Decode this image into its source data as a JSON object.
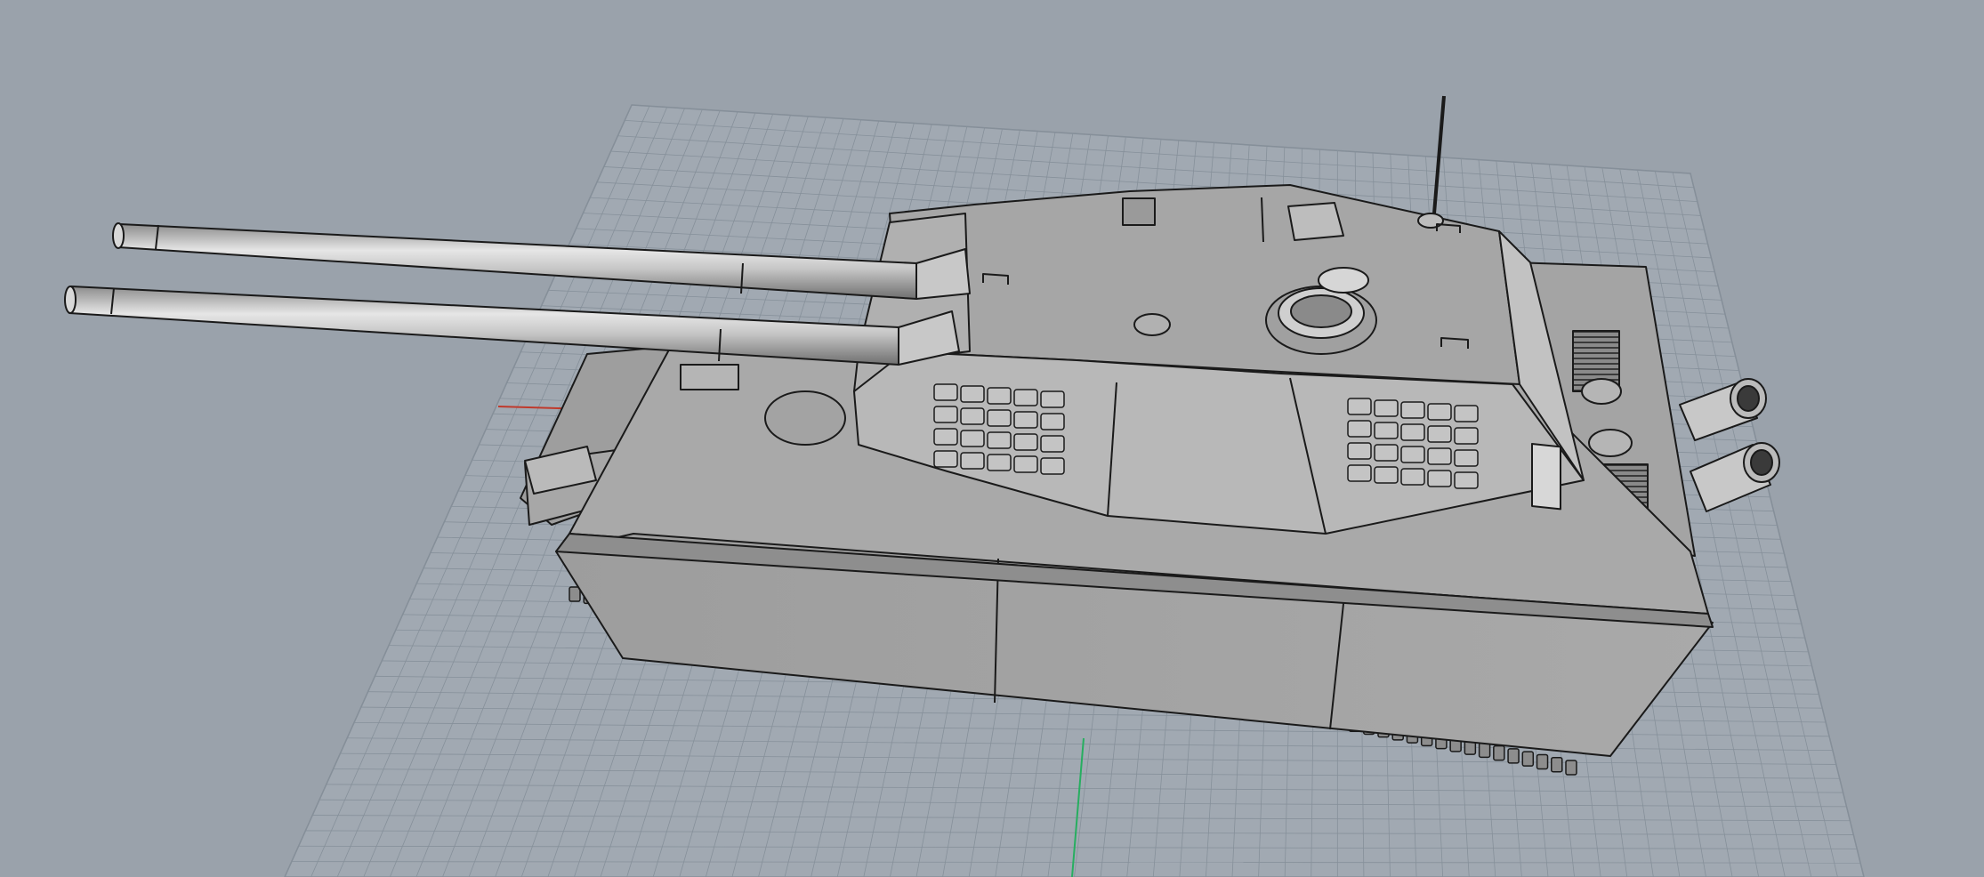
{
  "viewport": {
    "background": "#9aa2ab",
    "grid_color": "#7f8993",
    "x_axis_color": "#c0392b",
    "y_axis_color": "#27ae60",
    "model_fill": "#b9b9b9",
    "model_line": "#1a1a1a"
  }
}
